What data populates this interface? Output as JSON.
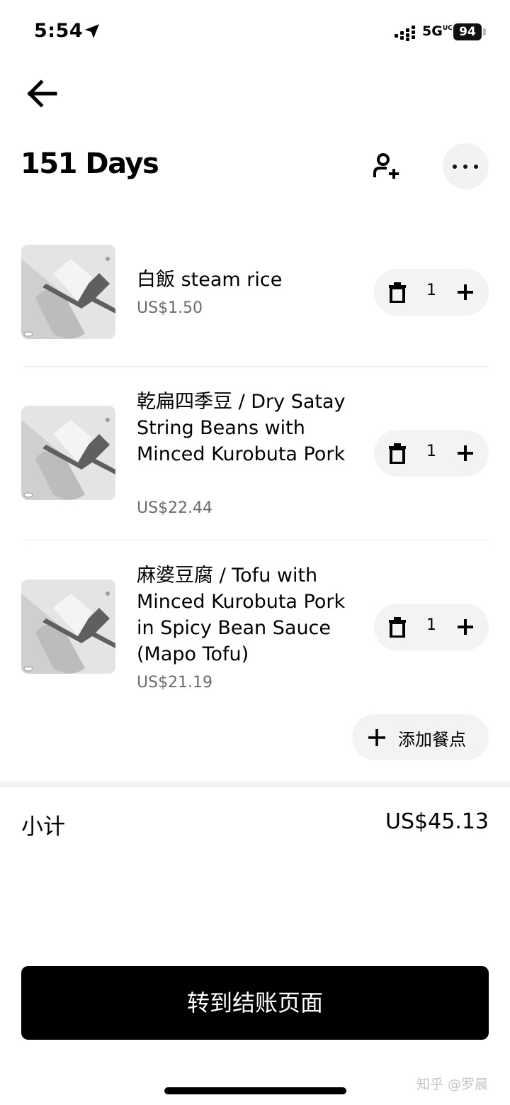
{
  "status_bar": {
    "time": "5:54",
    "network": "5G",
    "network_sub": "UC",
    "battery": "94"
  },
  "header": {
    "title": "151 Days"
  },
  "icons": {
    "back": "arrow-left-icon",
    "add_person": "add-person-icon",
    "more": "more-horizontal-icon",
    "trash": "trash-icon",
    "plus": "plus-icon"
  },
  "cart": {
    "items": [
      {
        "name": "白飯 steam rice",
        "price": "US$1.50",
        "quantity": "1"
      },
      {
        "name": "乾扁四季豆 / Dry Satay String Beans with Minced Kurobuta Pork",
        "price": "US$22.44",
        "quantity": "1"
      },
      {
        "name": "麻婆豆腐 / Tofu with Minced Kurobuta Pork in Spicy Bean Sauce (Mapo Tofu)",
        "price": "US$21.19",
        "quantity": "1"
      }
    ],
    "add_items_label": "添加餐点"
  },
  "summary": {
    "subtotal_label": "小计",
    "subtotal_value": "US$45.13"
  },
  "checkout": {
    "label": "转到结账页面"
  },
  "watermark": "知乎 @罗晨"
}
